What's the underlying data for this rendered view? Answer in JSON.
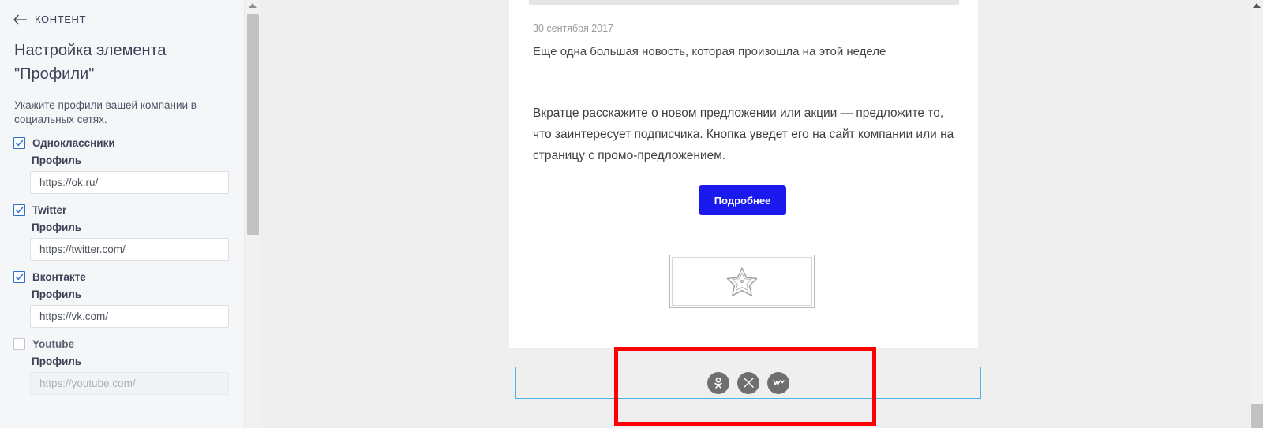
{
  "sidebar": {
    "back_label": "КОНТЕНТ",
    "title": "Настройка элемента \"Профили\"",
    "description": "Укажите профили вашей компании в социальных сетях.",
    "field_label": "Профиль",
    "options": [
      {
        "name": "Одноклассники",
        "checked": true,
        "value": "https://ok.ru/"
      },
      {
        "name": "Twitter",
        "checked": true,
        "value": "https://twitter.com/"
      },
      {
        "name": "Вконтакте",
        "checked": true,
        "value": "https://vk.com/"
      },
      {
        "name": "Youtube",
        "checked": false,
        "value": "https://youtube.com/"
      }
    ]
  },
  "content": {
    "date": "30 сентября 2017",
    "headline": "Еще одна большая новость, которая произошла на этой неделе",
    "body": "Вкратце расскажите о новом предложении или акции — предложите то, что заинтересует подписчика. Кнопка уведет его на сайт компании или на страницу с промо-предложением.",
    "cta_label": "Подробнее",
    "image_placeholder_icon": "starfish-icon"
  },
  "social_block": {
    "icons": [
      {
        "id": "odnoklassniki-icon",
        "label": "OK"
      },
      {
        "id": "x-twitter-icon",
        "label": "X"
      },
      {
        "id": "vk-icon",
        "label": "VK"
      }
    ]
  },
  "colors": {
    "accent_blue": "#1a1aee",
    "checkbox_blue": "#2f6fd0",
    "highlight_red": "#ff0000",
    "selection_cyan": "#4db4e8",
    "social_grey": "#6f6f6f"
  }
}
